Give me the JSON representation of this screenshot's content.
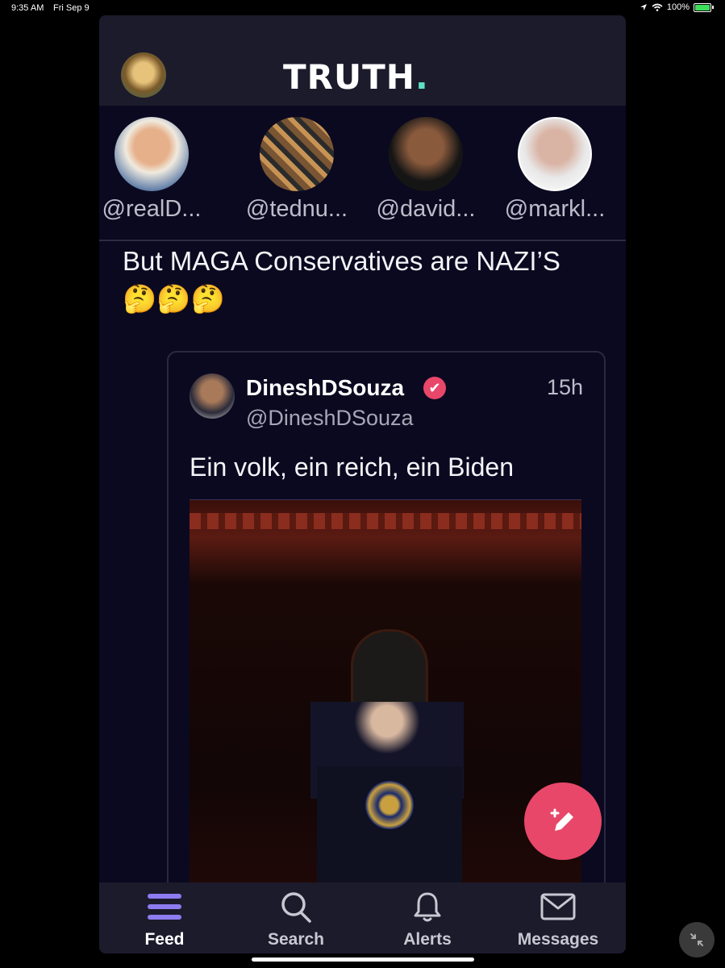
{
  "status_bar": {
    "time": "9:35 AM",
    "date": "Fri Sep 9",
    "battery": "100%"
  },
  "header": {
    "logo_text": "TRUTH",
    "logo_dot": "."
  },
  "stories": [
    {
      "handle": "@realD..."
    },
    {
      "handle": "@tednu..."
    },
    {
      "handle": "@david..."
    },
    {
      "handle": "@markl..."
    }
  ],
  "post": {
    "text": "But MAGA Conservatives are NAZI’S",
    "emojis": "🤔🤔🤔"
  },
  "quoted_post": {
    "author_name": "DineshDSouza",
    "author_handle": "@DineshDSouza",
    "timestamp": "15h",
    "text": "Ein volk, ein reich, ein Biden"
  },
  "tabbar": {
    "feed": "Feed",
    "search": "Search",
    "alerts": "Alerts",
    "messages": "Messages"
  },
  "colors": {
    "background": "#0b0920",
    "bar": "#1c1b2c",
    "accent": "#e8476a",
    "logo_dot": "#5de0c6",
    "active_tab": "#8c7cf0"
  }
}
